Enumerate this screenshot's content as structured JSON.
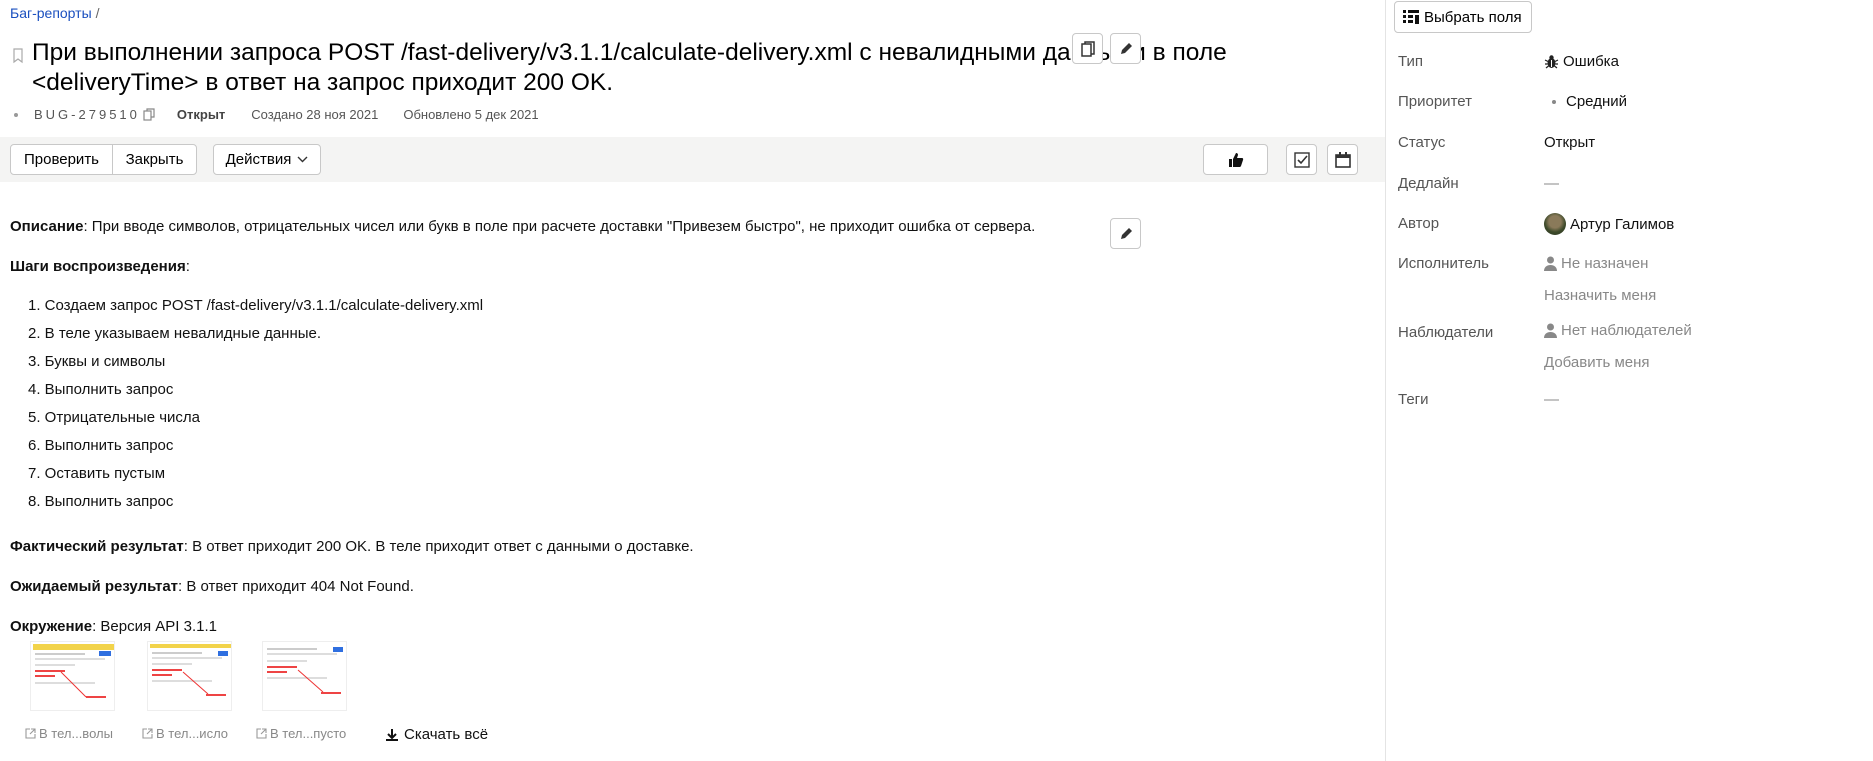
{
  "breadcrumb": {
    "parent": "Баг-репорты",
    "separator": "/"
  },
  "issue": {
    "title": "При выполнении запроса POST /fast-delivery/v3.1.1/calculate-delivery.xml с невалидными данными в поле <deliveryTime> в ответ на запрос приходит 200 OK.",
    "key": "BUG-279510",
    "status": "Открыт",
    "created": "Создано 28 ноя 2021",
    "updated": "Обновлено 5 дек 2021"
  },
  "toolbar": {
    "check_label": "Проверить",
    "close_label": "Закрыть",
    "actions_label": "Действия"
  },
  "description": {
    "label": "Описание",
    "text": ": При вводе символов, отрицательных чисел или букв в поле при расчете доставки \"Привезем быстро\", не приходит ошибка от сервера.",
    "steps_label": "Шаги воспроизведения",
    "steps_suffix": ":",
    "steps": [
      "1. Создаем запрос POST /fast-delivery/v3.1.1/calculate-delivery.xml",
      "2. В теле указываем невалидные данные.",
      "3. Буквы и символы",
      "4. Выполнить запрос",
      "5. Отрицательные числа",
      "6. Выполнить запрос",
      "7. Оставить пустым",
      "8. Выполнить запрос"
    ],
    "actual_label": "Фактический результат",
    "actual_text": ": В ответ приходит 200 OK. В теле приходит ответ с данными о доставке.",
    "expected_label": "Ожидаемый результат",
    "expected_text": ": В ответ приходит 404 Not Found.",
    "env_label": "Окружение",
    "env_text": ": Версия API 3.1.1"
  },
  "attachments": {
    "items": [
      {
        "name": "В тел...волы"
      },
      {
        "name": "В тел...исло"
      },
      {
        "name": "В тел...пусто"
      }
    ],
    "download_all": "Скачать всё"
  },
  "sidebar": {
    "fields_button": "Выбрать поля",
    "type_label": "Тип",
    "type_value": "Ошибка",
    "priority_label": "Приоритет",
    "priority_value": "Средний",
    "status_label": "Статус",
    "status_value": "Открыт",
    "deadline_label": "Дедлайн",
    "deadline_value": "—",
    "author_label": "Автор",
    "author_value": "Артур Галимов",
    "assignee_label": "Исполнитель",
    "assignee_value": "Не назначен",
    "assign_me": "Назначить меня",
    "watchers_label": "Наблюдатели",
    "watchers_value": "Нет наблюдателей",
    "add_me": "Добавить меня",
    "tags_label": "Теги",
    "tags_value": "—"
  },
  "colors": {
    "link": "#1a4fbf",
    "muted": "#888888",
    "toolbar_bg": "#f4f4f3"
  },
  "icons": [
    "bookmark-icon",
    "copy-icon",
    "edit-icon",
    "thumbs-up-icon",
    "checklist-icon",
    "calendar-icon",
    "chevron-down-icon",
    "external-link-icon",
    "download-icon",
    "fields-icon",
    "bug-icon",
    "user-icon"
  ]
}
